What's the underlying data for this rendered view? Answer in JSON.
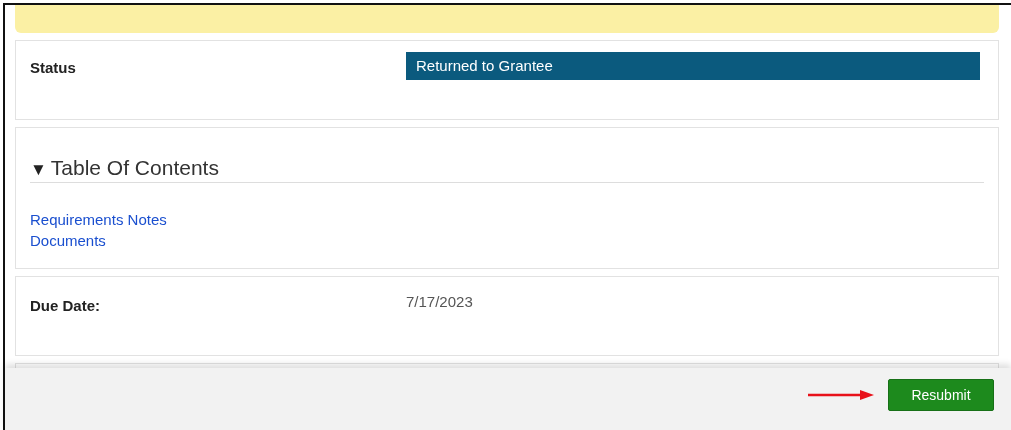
{
  "status": {
    "label": "Status",
    "value": "Returned to Grantee"
  },
  "toc": {
    "toggle": "▼",
    "title": "Table Of Contents",
    "links": [
      "Requirements Notes",
      "Documents"
    ]
  },
  "due_date": {
    "label": "Due Date:",
    "value": "7/17/2023"
  },
  "footer": {
    "button": "Resubmit"
  }
}
